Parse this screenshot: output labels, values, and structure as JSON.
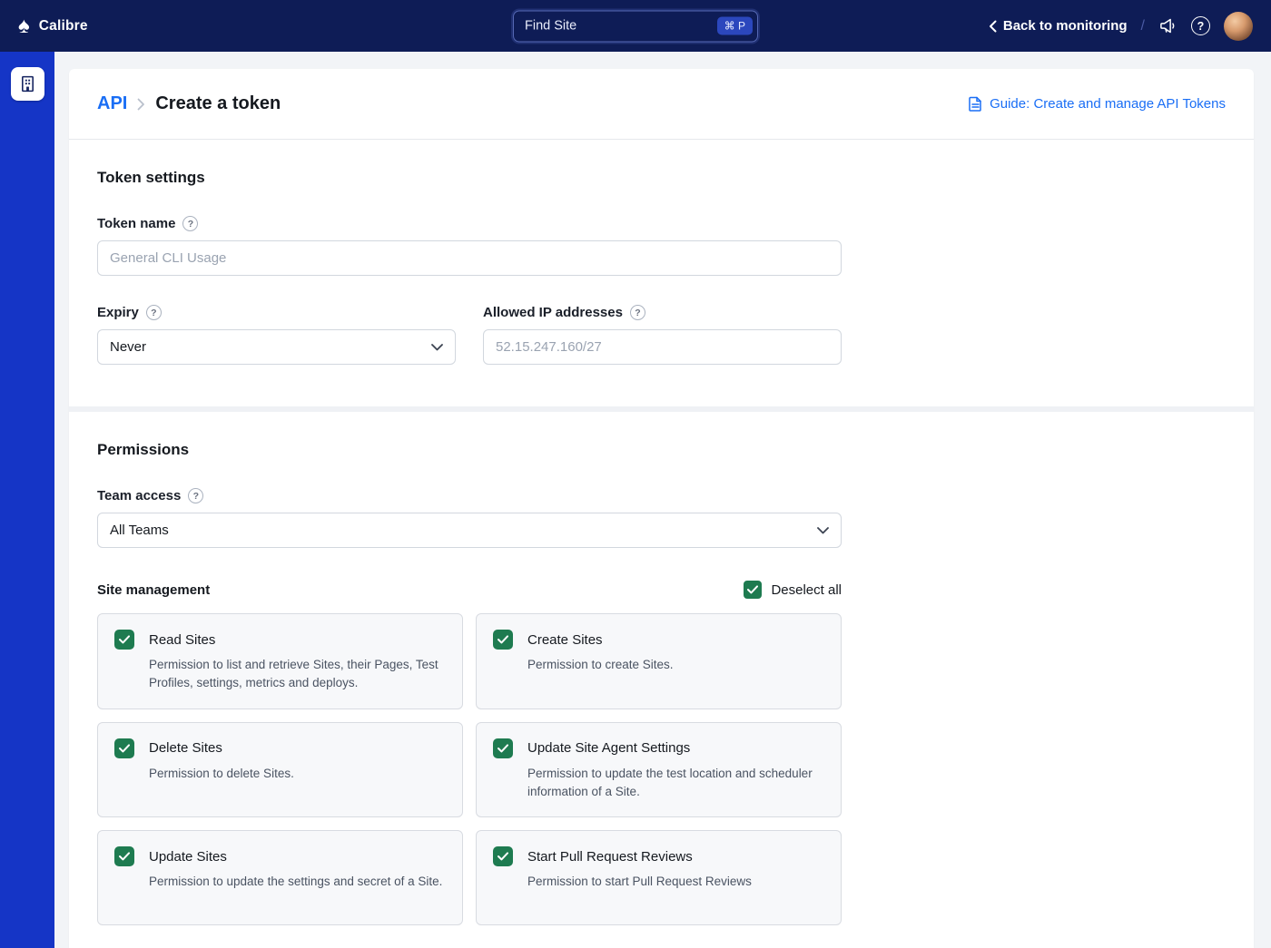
{
  "colors": {
    "navbar_bg": "#0e1c56",
    "sidebar_bg": "#1535c6",
    "accent_blue": "#1a6ef5",
    "checkbox_green": "#1e7b50"
  },
  "icons": {
    "logo": "♠",
    "help": "?"
  },
  "navbar": {
    "brand": "Calibre",
    "search": {
      "placeholder": "Find Site",
      "shortcut": "⌘ P"
    },
    "back_link": "Back to monitoring",
    "separator": "/"
  },
  "page": {
    "breadcrumb_section": "API",
    "breadcrumb_page": "Create a token",
    "guide_link": "Guide: Create and manage API Tokens"
  },
  "token_settings": {
    "heading": "Token settings",
    "token_name": {
      "label": "Token name",
      "placeholder": "General CLI Usage"
    },
    "expiry": {
      "label": "Expiry",
      "value": "Never"
    },
    "allowed_ip": {
      "label": "Allowed IP addresses",
      "placeholder": "52.15.247.160/27"
    }
  },
  "permissions": {
    "heading": "Permissions",
    "team_access": {
      "label": "Team access",
      "value": "All Teams"
    },
    "site_management": {
      "heading": "Site management",
      "deselect_all_label": "Deselect all",
      "checked": true
    },
    "cards": [
      {
        "title": "Read Sites",
        "description": "Permission to list and retrieve Sites, their Pages, Test Profiles, settings, metrics and deploys.",
        "checked": true
      },
      {
        "title": "Create Sites",
        "description": "Permission to create Sites.",
        "checked": true
      },
      {
        "title": "Delete Sites",
        "description": "Permission to delete Sites.",
        "checked": true
      },
      {
        "title": "Update Site Agent Settings",
        "description": "Permission to update the test location and scheduler information of a Site.",
        "checked": true
      },
      {
        "title": "Update Sites",
        "description": "Permission to update the settings and secret of a Site.",
        "checked": true
      },
      {
        "title": "Start Pull Request Reviews",
        "description": "Permission to start Pull Request Reviews",
        "checked": true
      }
    ]
  }
}
